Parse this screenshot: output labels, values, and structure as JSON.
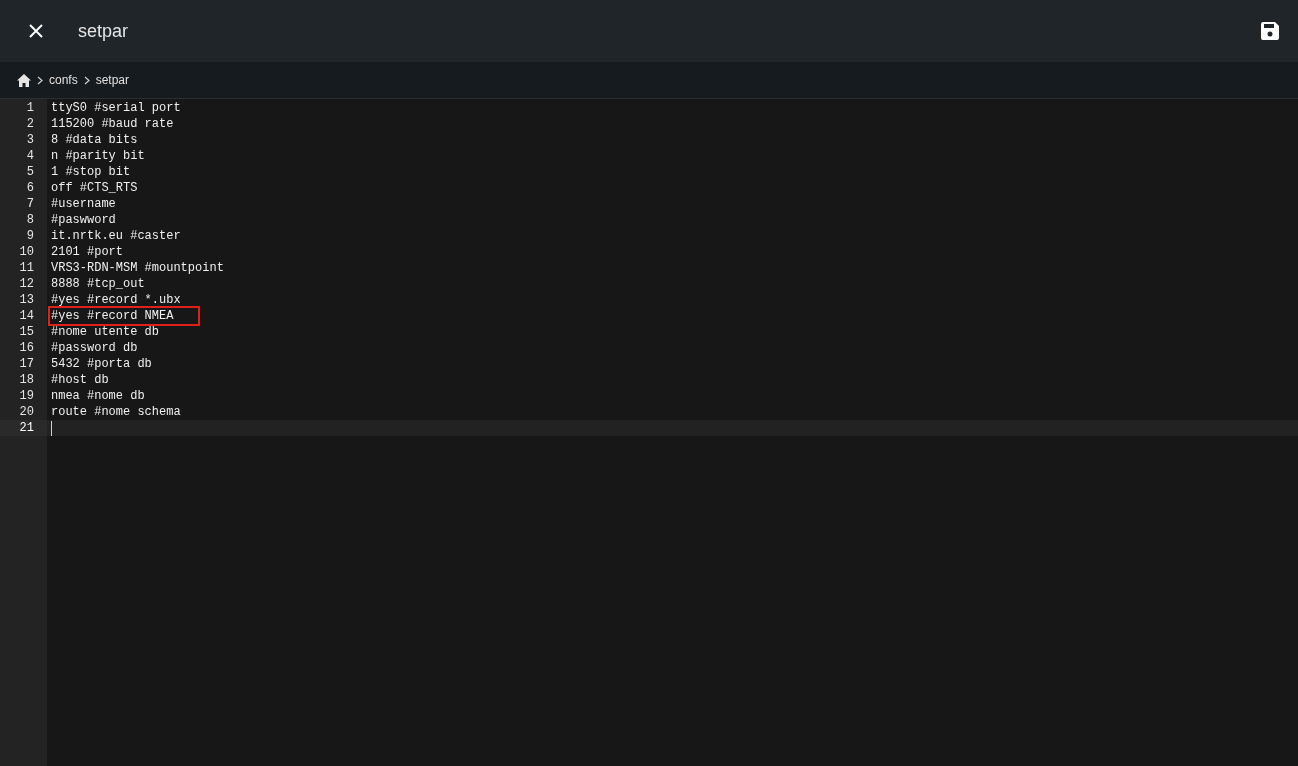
{
  "header": {
    "title": "setpar"
  },
  "breadcrumb": [
    "confs",
    "setpar"
  ],
  "editor": {
    "lines": [
      {
        "number": "1",
        "text": "ttyS0 #serial port",
        "active": false,
        "highlighted": false
      },
      {
        "number": "2",
        "text": "115200 #baud rate",
        "active": false,
        "highlighted": false
      },
      {
        "number": "3",
        "text": "8 #data bits",
        "active": false,
        "highlighted": false
      },
      {
        "number": "4",
        "text": "n #parity bit",
        "active": false,
        "highlighted": false
      },
      {
        "number": "5",
        "text": "1 #stop bit",
        "active": false,
        "highlighted": false
      },
      {
        "number": "6",
        "text": "off #CTS_RTS",
        "active": false,
        "highlighted": false
      },
      {
        "number": "7",
        "text": "#username",
        "active": false,
        "highlighted": false
      },
      {
        "number": "8",
        "text": "#paswword",
        "active": false,
        "highlighted": false
      },
      {
        "number": "9",
        "text": "it.nrtk.eu #caster",
        "active": false,
        "highlighted": false
      },
      {
        "number": "10",
        "text": "2101 #port",
        "active": false,
        "highlighted": false
      },
      {
        "number": "11",
        "text": "VRS3-RDN-MSM #mountpoint",
        "active": false,
        "highlighted": false
      },
      {
        "number": "12",
        "text": "8888 #tcp_out",
        "active": false,
        "highlighted": false
      },
      {
        "number": "13",
        "text": "#yes #record *.ubx",
        "active": false,
        "highlighted": false
      },
      {
        "number": "14",
        "text": "#yes #record NMEA",
        "active": false,
        "highlighted": true
      },
      {
        "number": "15",
        "text": "#nome utente db",
        "active": false,
        "highlighted": false
      },
      {
        "number": "16",
        "text": "#password db",
        "active": false,
        "highlighted": false
      },
      {
        "number": "17",
        "text": "5432 #porta db",
        "active": false,
        "highlighted": false
      },
      {
        "number": "18",
        "text": "#host db",
        "active": false,
        "highlighted": false
      },
      {
        "number": "19",
        "text": "nmea #nome db",
        "active": false,
        "highlighted": false
      },
      {
        "number": "20",
        "text": "route #nome schema",
        "active": false,
        "highlighted": false
      },
      {
        "number": "21",
        "active": true,
        "highlighted": false
      }
    ]
  }
}
